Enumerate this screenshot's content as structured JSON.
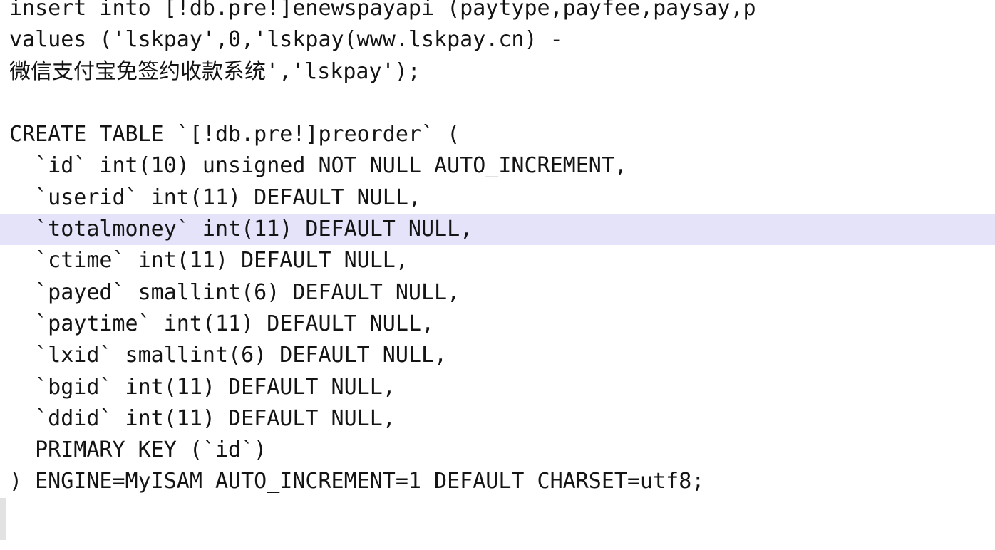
{
  "editor": {
    "language": "sql",
    "background_color": "#ffffff",
    "text_color": "#141414",
    "gutter_color": "#e2e2e2",
    "highlight_color": "#e4e3fa",
    "highlighted_line_index": 8,
    "lines": [
      {
        "text": "insert into [!db.pre!]enewspayapi (paytype,payfee,paysay,p",
        "highlighted": false,
        "cjk": false,
        "clipped_right": true
      },
      {
        "text": "values ('lskpay',0,'lskpay(www.lskpay.cn) -",
        "highlighted": false,
        "cjk": false,
        "clipped_right": false
      },
      {
        "text": "微信支付宝免签约收款系统','lskpay');",
        "highlighted": false,
        "cjk": true,
        "clipped_right": false
      },
      {
        "text": "",
        "highlighted": false,
        "cjk": false,
        "clipped_right": false
      },
      {
        "text": "CREATE TABLE `[!db.pre!]preorder` (",
        "highlighted": false,
        "cjk": false,
        "clipped_right": false
      },
      {
        "text": "  `id` int(10) unsigned NOT NULL AUTO_INCREMENT,",
        "highlighted": false,
        "cjk": false,
        "clipped_right": false
      },
      {
        "text": "  `userid` int(11) DEFAULT NULL,",
        "highlighted": false,
        "cjk": false,
        "clipped_right": false
      },
      {
        "text": "  `totalmoney` int(11) DEFAULT NULL,",
        "highlighted": true,
        "cjk": false,
        "clipped_right": false
      },
      {
        "text": "  `ctime` int(11) DEFAULT NULL,",
        "highlighted": false,
        "cjk": false,
        "clipped_right": false
      },
      {
        "text": "  `payed` smallint(6) DEFAULT NULL,",
        "highlighted": false,
        "cjk": false,
        "clipped_right": false
      },
      {
        "text": "  `paytime` int(11) DEFAULT NULL,",
        "highlighted": false,
        "cjk": false,
        "clipped_right": false
      },
      {
        "text": "  `lxid` smallint(6) DEFAULT NULL,",
        "highlighted": false,
        "cjk": false,
        "clipped_right": false
      },
      {
        "text": "  `bgid` int(11) DEFAULT NULL,",
        "highlighted": false,
        "cjk": false,
        "clipped_right": false
      },
      {
        "text": "  `ddid` int(11) DEFAULT NULL,",
        "highlighted": false,
        "cjk": false,
        "clipped_right": false
      },
      {
        "text": "  PRIMARY KEY (`id`)",
        "highlighted": false,
        "cjk": false,
        "clipped_right": false
      },
      {
        "text": ") ENGINE=MyISAM AUTO_INCREMENT=1 DEFAULT CHARSET=utf8;",
        "highlighted": false,
        "cjk": false,
        "clipped_right": false
      }
    ]
  }
}
